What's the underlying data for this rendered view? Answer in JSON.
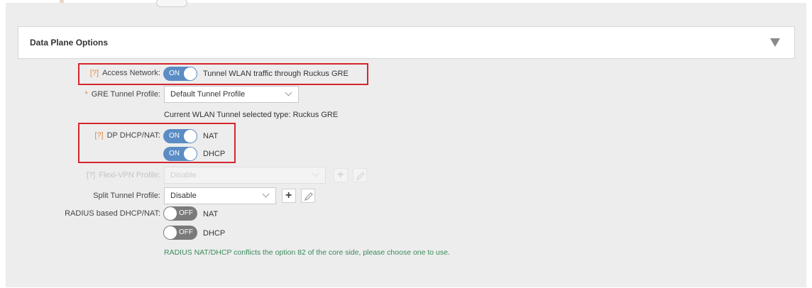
{
  "section": {
    "title": "Data Plane Options"
  },
  "help_marker": "[?]",
  "required_marker": "*",
  "access_network": {
    "label": "Access Network:",
    "toggle_state": "ON",
    "description": "Tunnel WLAN traffic through Ruckus GRE"
  },
  "gre_tunnel_profile": {
    "label": "GRE Tunnel Profile:",
    "value": "Default Tunnel Profile",
    "info": "Current WLAN Tunnel selected type: Ruckus GRE"
  },
  "dp_dhcp_nat": {
    "label": "DP DHCP/NAT:",
    "nat": {
      "toggle_state": "ON",
      "text": "NAT"
    },
    "dhcp": {
      "toggle_state": "ON",
      "text": "DHCP"
    }
  },
  "flexi_vpn_profile": {
    "label": "Flexi-VPN Profile:",
    "value": "Disable"
  },
  "split_tunnel_profile": {
    "label": "Split Tunnel Profile:",
    "value": "Disable"
  },
  "radius_dhcp_nat": {
    "label": "RADIUS based DHCP/NAT:",
    "nat": {
      "toggle_state": "OFF",
      "text": "NAT"
    },
    "dhcp": {
      "toggle_state": "OFF",
      "text": "DHCP"
    },
    "note": "RADIUS NAT/DHCP conflicts the option 82 of the core side, please choose one to use."
  },
  "icons": {
    "collapse": "triangle-down-icon",
    "add": "plus-icon",
    "edit": "pencil-icon"
  },
  "colors": {
    "toggle_on": "#5b8cc4",
    "toggle_off": "#7a7a7a",
    "help_marker": "#e8893a",
    "highlight_border": "#d4262f",
    "note_text": "#3a8a5c"
  }
}
